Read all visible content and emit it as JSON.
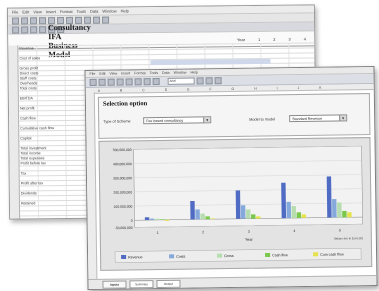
{
  "back_window": {
    "menu_items": [
      "File",
      "Edit",
      "View",
      "Insert",
      "Format",
      "Tools",
      "Data",
      "Window",
      "Help"
    ],
    "title": "Consultancy IFA Business Model",
    "column_headers": [
      "Year",
      "1",
      "2",
      "3",
      "4",
      "5"
    ],
    "row_labels": [
      "Revenue",
      "",
      "Cost of sales",
      "",
      "Gross profit",
      "Direct costs",
      "Staff costs",
      "Overheads",
      "Total costs",
      "",
      "EBITDA",
      "",
      "Net profit",
      "",
      "Cash flow",
      "",
      "Cumulative cash flow",
      "",
      "Capital",
      "",
      "Total investment",
      "Total income",
      "Total expenses",
      "Profit before tax",
      "",
      "Tax",
      "",
      "Profit after tax",
      "",
      "Dividends",
      "",
      "Retained"
    ],
    "value_rows": [
      [
        "",
        "",
        "",
        "",
        ""
      ],
      [
        "",
        "",
        "",
        "",
        ""
      ],
      [
        "",
        "",
        "",
        "",
        ""
      ],
      [
        "",
        "",
        "",
        "",
        ""
      ],
      [
        "",
        "",
        "",
        "",
        ""
      ],
      [
        "",
        "",
        "",
        "",
        ""
      ],
      [
        "",
        "",
        "",
        "",
        ""
      ],
      [
        "",
        "",
        "",
        "",
        ""
      ]
    ]
  },
  "front_window": {
    "menu_items": [
      "File",
      "Edit",
      "View",
      "Insert",
      "Format",
      "Tools",
      "Data",
      "Window",
      "Help"
    ],
    "toolbar_combo": "Arial",
    "col_headers": [
      "A",
      "B",
      "C",
      "D",
      "E",
      "F",
      "G",
      "H",
      "I",
      "J",
      "K"
    ],
    "selection": {
      "title": "Selection option",
      "type_label": "Type of Scheme",
      "type_value": "Fee based consultancy",
      "model_label": "Model to model",
      "model_value": "Standard Revenue"
    },
    "sheet_tabs": [
      "Inputs",
      "Summary",
      "Output"
    ]
  },
  "chart_data": {
    "type": "bar",
    "x": [
      1,
      2,
      3,
      4,
      5
    ],
    "categories": [
      "1",
      "2",
      "3",
      "4",
      "5"
    ],
    "xlabel": "Year",
    "ylabel": "",
    "ylim": [
      -50000000,
      500000000
    ],
    "yticks": [
      "500,000,000",
      "400,000,000",
      "300,000,000",
      "200,000,000",
      "100,000,000",
      "0",
      "-50,000,000"
    ],
    "note": "Values are in Euro (€)",
    "series": [
      {
        "name": "Revenue",
        "color": "#4f6bc4",
        "values": [
          20000000,
          130000000,
          200000000,
          250000000,
          290000000
        ]
      },
      {
        "name": "Costs",
        "color": "#86a9dc",
        "values": [
          10000000,
          70000000,
          95000000,
          115000000,
          130000000
        ]
      },
      {
        "name": "Gross",
        "color": "#b6ddb0",
        "values": [
          8000000,
          40000000,
          65000000,
          85000000,
          105000000
        ]
      },
      {
        "name": "Cash flow",
        "color": "#79c84a",
        "values": [
          4000000,
          20000000,
          30000000,
          40000000,
          45000000
        ]
      },
      {
        "name": "Cum cash flow",
        "color": "#e6e24a",
        "values": [
          -8000000,
          5000000,
          15000000,
          25000000,
          35000000
        ]
      }
    ]
  }
}
